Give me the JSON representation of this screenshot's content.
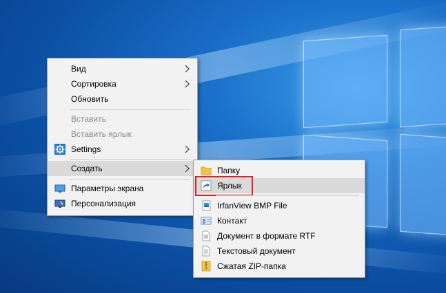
{
  "context_menu": {
    "items": [
      {
        "label": "Вид",
        "has_submenu": true,
        "enabled": true
      },
      {
        "label": "Сортировка",
        "has_submenu": true,
        "enabled": true
      },
      {
        "label": "Обновить",
        "has_submenu": false,
        "enabled": true
      },
      {
        "label": "Вставить",
        "has_submenu": false,
        "enabled": false
      },
      {
        "label": "Вставить ярлык",
        "has_submenu": false,
        "enabled": false
      },
      {
        "label": "Settings",
        "has_submenu": true,
        "enabled": true,
        "icon": "gear-icon"
      },
      {
        "label": "Создать",
        "has_submenu": true,
        "enabled": true,
        "highlighted": true
      },
      {
        "label": "Параметры экрана",
        "has_submenu": false,
        "enabled": true,
        "icon": "display-icon"
      },
      {
        "label": "Персонализация",
        "has_submenu": false,
        "enabled": true,
        "icon": "personalization-icon"
      }
    ]
  },
  "submenu_create": {
    "items": [
      {
        "label": "Папку",
        "icon": "folder-icon"
      },
      {
        "label": "Ярлык",
        "icon": "shortcut-icon",
        "highlighted": true
      },
      {
        "label": "IrfanView BMP File",
        "icon": "bmp-file-icon"
      },
      {
        "label": "Контакт",
        "icon": "contact-icon"
      },
      {
        "label": "Документ в формате RTF",
        "icon": "rtf-document-icon"
      },
      {
        "label": "Текстовый документ",
        "icon": "text-document-icon"
      },
      {
        "label": "Сжатая ZIP-папка",
        "icon": "zip-folder-icon"
      }
    ]
  },
  "colors": {
    "menu_bg": "#f2f2f2",
    "hover_bg": "#dadada",
    "disabled_text": "#8a8a8a",
    "highlight_border": "#e02020",
    "desktop_blue": "#0b4fa3"
  }
}
